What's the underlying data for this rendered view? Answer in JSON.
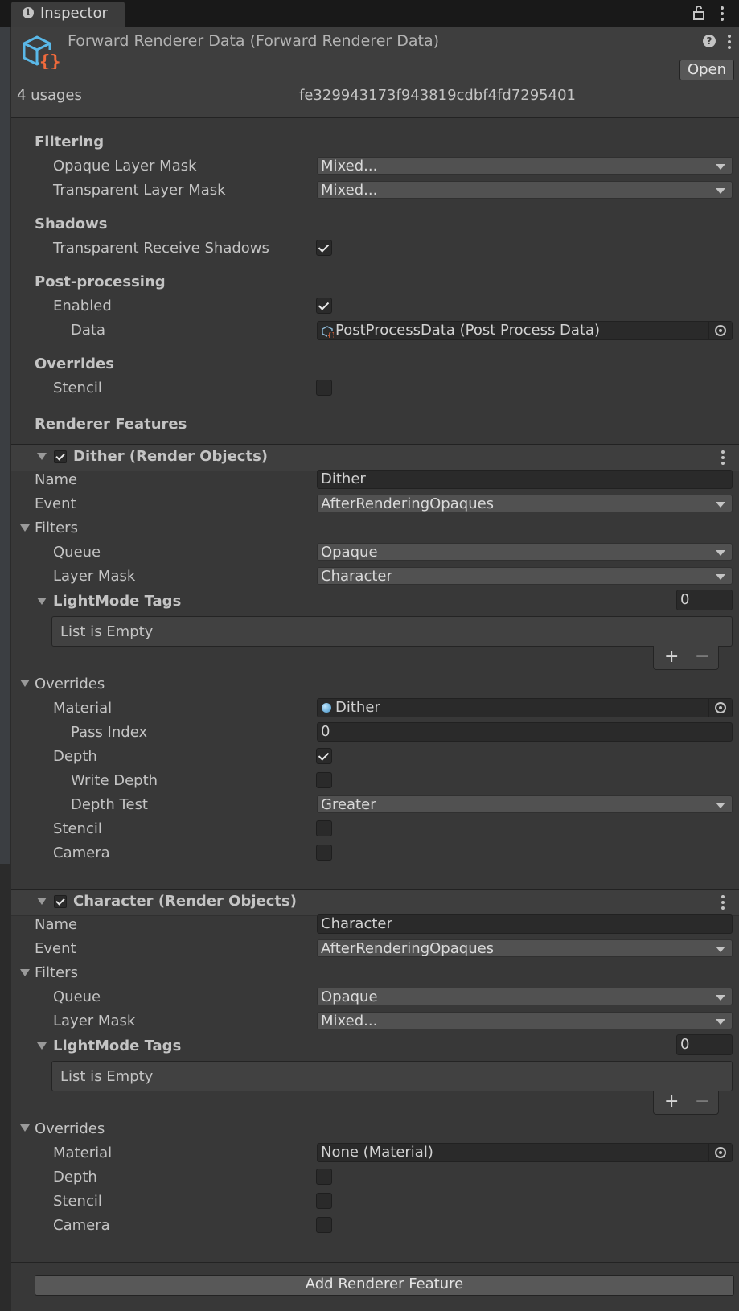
{
  "window": {
    "tab_label": "Inspector"
  },
  "header": {
    "title": "Forward Renderer Data (Forward Renderer Data)",
    "open_label": "Open",
    "usages": "4 usages",
    "guid": "fe329943173f943819cdbf4fd7295401"
  },
  "filtering": {
    "title": "Filtering",
    "opaque_label": "Opaque Layer Mask",
    "opaque_value": "Mixed...",
    "transparent_label": "Transparent Layer Mask",
    "transparent_value": "Mixed..."
  },
  "shadows": {
    "title": "Shadows",
    "receive_label": "Transparent Receive Shadows",
    "receive_checked": true
  },
  "postprocessing": {
    "title": "Post-processing",
    "enabled_label": "Enabled",
    "enabled_checked": true,
    "data_label": "Data",
    "data_value": "PostProcessData (Post Process Data)"
  },
  "overrides": {
    "title": "Overrides",
    "stencil_label": "Stencil",
    "stencil_checked": false
  },
  "renderer_features": {
    "title": "Renderer Features",
    "add_label": "Add Renderer Feature"
  },
  "features": [
    {
      "title": "Dither (Render Objects)",
      "name_label": "Name",
      "name_value": "Dither",
      "event_label": "Event",
      "event_value": "AfterRenderingOpaques",
      "filters_label": "Filters",
      "queue_label": "Queue",
      "queue_value": "Opaque",
      "layer_label": "Layer Mask",
      "layer_value": "Character",
      "tags_label": "LightMode Tags",
      "tags_count": "0",
      "list_empty": "List is Empty",
      "plus": "+",
      "minus": "−",
      "overrides_label": "Overrides",
      "material_label": "Material",
      "material_value": "Dither",
      "pass_label": "Pass Index",
      "pass_value": "0",
      "depth_label": "Depth",
      "write_depth_label": "Write Depth",
      "depth_test_label": "Depth Test",
      "depth_test_value": "Greater",
      "stencil_label": "Stencil",
      "camera_label": "Camera"
    },
    {
      "title": "Character (Render Objects)",
      "name_label": "Name",
      "name_value": "Character",
      "event_label": "Event",
      "event_value": "AfterRenderingOpaques",
      "filters_label": "Filters",
      "queue_label": "Queue",
      "queue_value": "Opaque",
      "layer_label": "Layer Mask",
      "layer_value": "Mixed...",
      "tags_label": "LightMode Tags",
      "tags_count": "0",
      "list_empty": "List is Empty",
      "plus": "+",
      "minus": "−",
      "overrides_label": "Overrides",
      "material_label": "Material",
      "material_value": "None (Material)",
      "depth_label": "Depth",
      "stencil_label": "Stencil",
      "camera_label": "Camera"
    }
  ],
  "colors": {
    "panel": "#383838",
    "header": "#3e3e3e",
    "field": "#2a2a2a",
    "dropdown": "#515151",
    "asset_blue": "#5ab8e8",
    "asset_orange": "#f06a3c"
  }
}
